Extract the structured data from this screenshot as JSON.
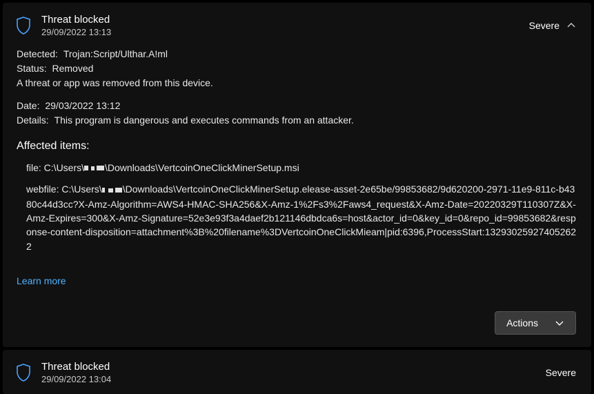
{
  "threats": [
    {
      "title": "Threat blocked",
      "timestamp": "29/09/2022 13:13",
      "severity": "Severe",
      "expanded": true,
      "detected_label": "Detected:",
      "detected_value": "Trojan:Script/Ulthar.A!ml",
      "status_label": "Status:",
      "status_value": "Removed",
      "status_note": "A threat or app was removed from this device.",
      "date_label": "Date:",
      "date_value": "29/03/2022 13:12",
      "details_label": "Details:",
      "details_value": "This program is dangerous and executes commands from an attacker.",
      "affected_heading": "Affected items:",
      "affected_file_prefix": "file: C:\\Users\\",
      "affected_file_suffix": "\\Downloads\\VertcoinOneClickMinerSetup.msi",
      "affected_webfile_prefix": "webfile: C:\\Users\\",
      "affected_webfile_suffix": "\\Downloads\\VertcoinOneClickMinerSetup.elease-asset-2e65be/99853682/9d620200-2971-11e9-811c-b4380c44d3cc?X-Amz-Algorithm=AWS4-HMAC-SHA256&X-Amz-1%2Fs3%2Faws4_request&X-Amz-Date=20220329T110307Z&X-Amz-Expires=300&X-Amz-Signature=52e3e93f3a4daef2b121146dbdca6s=host&actor_id=0&key_id=0&repo_id=99853682&response-content-disposition=attachment%3B%20filename%3DVertcoinOneClickMieam|pid:6396,ProcessStart:132930259274052622",
      "learn_more": "Learn more",
      "actions_label": "Actions"
    },
    {
      "title": "Threat blocked",
      "timestamp": "29/09/2022 13:04",
      "severity": "Severe",
      "expanded": false
    }
  ]
}
